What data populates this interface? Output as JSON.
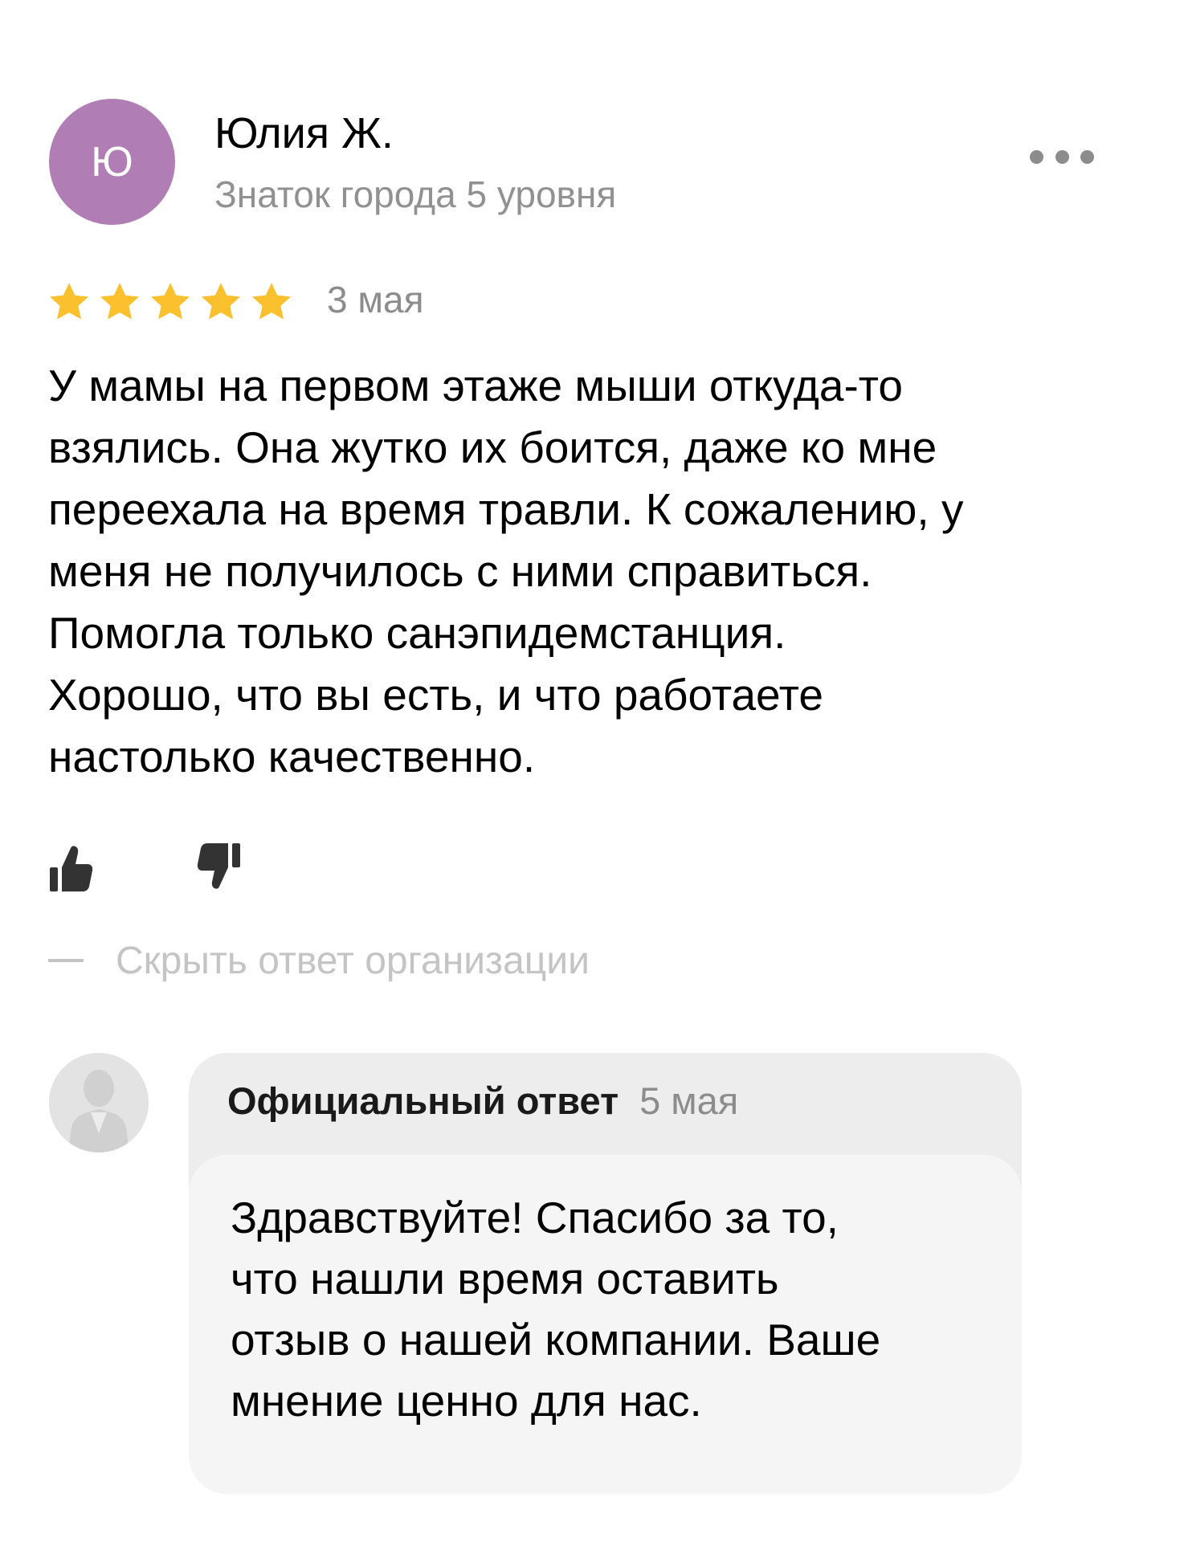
{
  "review": {
    "author": {
      "initial": "Ю",
      "name": "Юлия Ж.",
      "level": "Знаток города 5 уровня",
      "avatar_color": "#b07db4"
    },
    "rating": 5,
    "rating_max": 5,
    "star_color": "#fbc02d",
    "date": "3 мая",
    "text_lines": [
      "У мамы на первом этаже мыши откуда-то",
      "взялись. Она жутко их боится, даже ко мне",
      "переехала на время травли. К сожалению, у",
      "меня не получилось с ними справиться.",
      "Помогла только санэпидемстанция.",
      "Хорошо, что вы есть, и что работаете",
      "настолько качественно."
    ],
    "more_icon": "more-dots-icon",
    "like_icon": "thumbs-up-icon",
    "dislike_icon": "thumbs-down-icon"
  },
  "hide_reply_label": "Скрыть ответ организации",
  "reply": {
    "title": "Официальный ответ",
    "date": "5 мая",
    "avatar_icon": "person-silhouette-icon",
    "text_lines": [
      "Здравствуйте! Спасибо за то,",
      "что нашли время оставить",
      "отзыв о нашей компании. Ваше",
      "мнение ценно для нас."
    ]
  }
}
